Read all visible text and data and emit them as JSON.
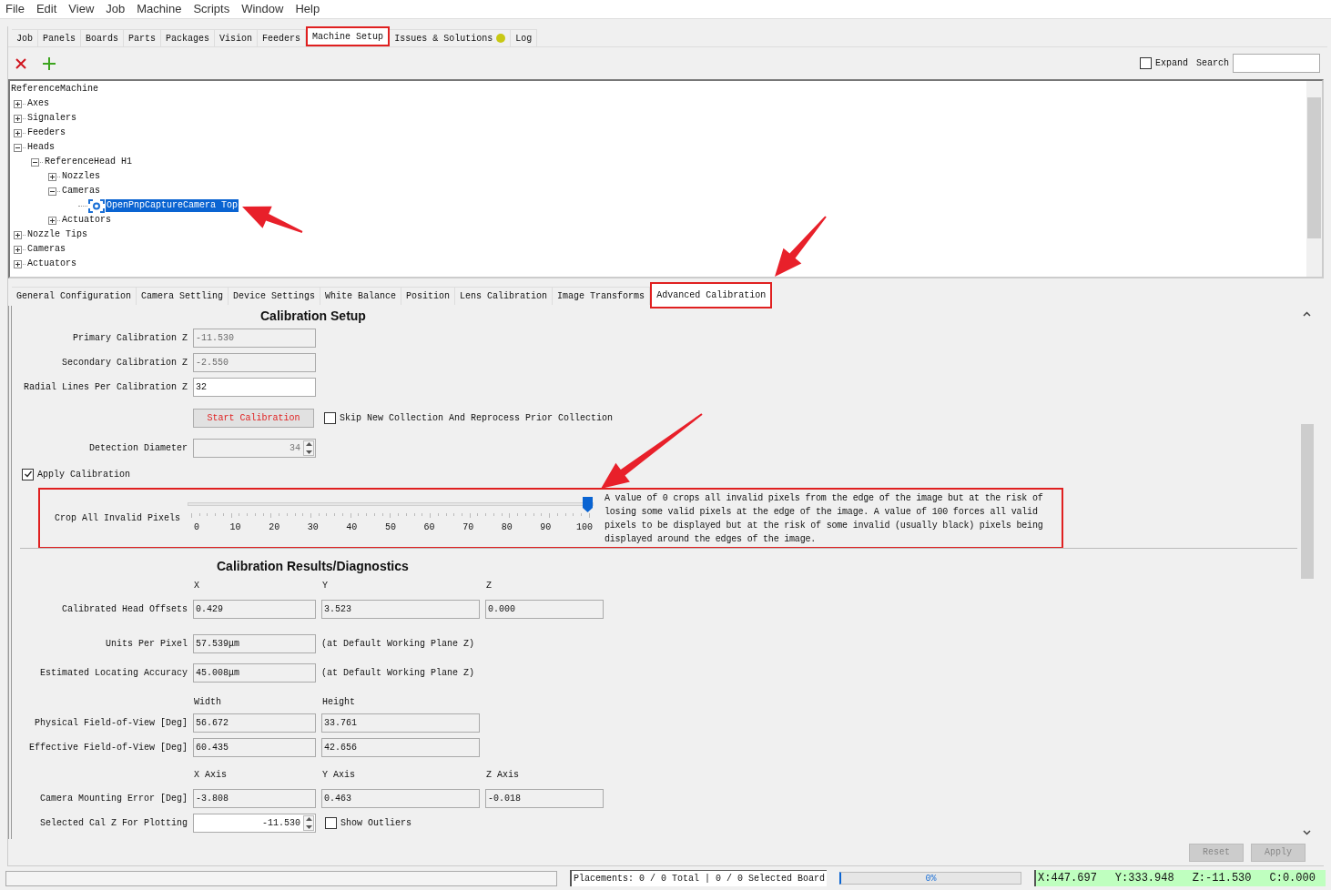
{
  "menu": [
    "File",
    "Edit",
    "View",
    "Job",
    "Machine",
    "Scripts",
    "Window",
    "Help"
  ],
  "main_tabs": [
    {
      "label": "Job",
      "selected": false
    },
    {
      "label": "Panels",
      "selected": false
    },
    {
      "label": "Boards",
      "selected": false
    },
    {
      "label": "Parts",
      "selected": false
    },
    {
      "label": "Packages",
      "selected": false
    },
    {
      "label": "Vision",
      "selected": false
    },
    {
      "label": "Feeders",
      "selected": false
    },
    {
      "label": "Machine Setup",
      "selected": true
    },
    {
      "label": "Issues & Solutions",
      "selected": false,
      "color": "#c8c814"
    },
    {
      "label": "Log",
      "selected": false
    }
  ],
  "toolbar": {
    "expand": {
      "label": "Expand",
      "checked": false
    },
    "search_label": "Search"
  },
  "tree": {
    "label": "ReferenceMachine",
    "selected": false,
    "children": [
      {
        "label": "Axes",
        "kind": "group",
        "selected": false,
        "expanded": false
      },
      {
        "label": "Signalers",
        "kind": "group",
        "selected": false,
        "expanded": false
      },
      {
        "label": "Feeders",
        "kind": "group",
        "selected": false,
        "expanded": false
      },
      {
        "label": "Heads",
        "kind": "group",
        "selected": false,
        "expanded": true,
        "children": [
          {
            "label": "ReferenceHead H1",
            "kind": "group",
            "selected": false,
            "expanded": true,
            "children": [
              {
                "label": "Nozzles",
                "kind": "group",
                "selected": false,
                "expanded": false
              },
              {
                "label": "Cameras",
                "kind": "group",
                "selected": false,
                "expanded": true,
                "children": [
                  {
                    "label": "OpenPnpCaptureCamera Top",
                    "kind": "camera",
                    "selected": true
                  }
                ]
              },
              {
                "label": "Actuators",
                "kind": "group",
                "selected": false,
                "expanded": false
              }
            ]
          }
        ]
      },
      {
        "label": "Nozzle Tips",
        "kind": "group",
        "selected": false,
        "expanded": false
      },
      {
        "label": "Cameras",
        "kind": "group",
        "selected": false,
        "expanded": false
      },
      {
        "label": "Actuators",
        "kind": "group",
        "selected": false,
        "expanded": false
      }
    ]
  },
  "sub_tabs": [
    {
      "label": "General Configuration",
      "selected": false
    },
    {
      "label": "Camera Settling",
      "selected": false
    },
    {
      "label": "Device Settings",
      "selected": false
    },
    {
      "label": "White Balance",
      "selected": false
    },
    {
      "label": "Position",
      "selected": false
    },
    {
      "label": "Lens Calibration",
      "selected": false
    },
    {
      "label": "Image Transforms",
      "selected": false
    },
    {
      "label": "Advanced Calibration",
      "selected": true
    }
  ],
  "calibration_setup": {
    "title": "Calibration Setup",
    "fields": [
      {
        "label": "Primary Calibration Z",
        "value": "-11.530",
        "disabled": true
      },
      {
        "label": "Secondary Calibration Z",
        "value": "-2.550",
        "disabled": true
      },
      {
        "label": "Radial Lines Per Calibration Z",
        "value": "32",
        "disabled": false
      }
    ],
    "start_button": "Start Calibration",
    "skip_checkbox": {
      "label": "Skip New Collection And Reprocess Prior Collection",
      "checked": false
    },
    "detection_diameter": {
      "label": "Detection Diameter",
      "value": "34",
      "disabled": true
    },
    "apply_calibration": {
      "label": "Apply Calibration",
      "checked": true
    },
    "crop": {
      "label": "Crop All Invalid Pixels",
      "level": 1,
      "ticks": [
        "0",
        "10",
        "20",
        "30",
        "40",
        "50",
        "60",
        "70",
        "80",
        "90",
        "100"
      ],
      "description": "A value of 0 crops all invalid pixels from the edge of the image but at the risk of losing some valid pixels at the edge of the image. A value of 100 forces all valid pixels to be displayed but at the risk of some invalid (usually black) pixels being displayed around the edges of the image."
    }
  },
  "results": {
    "title": "Calibration Results/Diagnostics",
    "sections": [
      {
        "headers": [
          "X",
          "Y",
          "Z"
        ],
        "rows": [
          {
            "label": "Calibrated Head Offsets",
            "values": [
              "0.429",
              "3.523",
              "0.000"
            ]
          }
        ]
      },
      {
        "rows": [
          {
            "label": "Units Per Pixel",
            "values": [
              "57.539μm"
            ],
            "note": "(at Default Working Plane Z)"
          },
          {
            "label": "Estimated Locating Accuracy",
            "values": [
              "45.008μm"
            ],
            "note": "(at Default Working Plane Z)"
          }
        ]
      },
      {
        "headers": [
          "Width",
          "Height"
        ],
        "rows": [
          {
            "label": "Physical Field-of-View [Deg]",
            "values": [
              "56.672",
              "33.761"
            ]
          },
          {
            "label": "Effective Field-of-View [Deg]",
            "values": [
              "60.435",
              "42.656"
            ]
          }
        ]
      },
      {
        "headers": [
          "X Axis",
          "Y Axis",
          "Z Axis"
        ],
        "rows": [
          {
            "label": "Camera Mounting Error [Deg]",
            "values": [
              "-3.808",
              "0.463",
              "-0.018"
            ]
          }
        ]
      }
    ],
    "plotting": {
      "label": "Selected Cal Z For Plotting",
      "value": "-11.530"
    },
    "show_outliers": {
      "label": "Show Outliers",
      "checked": false
    }
  },
  "buttons": [
    {
      "label": "Reset",
      "disabled": true
    },
    {
      "label": "Apply",
      "disabled": true
    }
  ],
  "status_bar": {
    "placements": "Placements: 0 / 0 Total | 0 / 0 Selected Board",
    "progress": {
      "level": 0,
      "label": "0%"
    },
    "coordinates": [
      "X:447.697",
      "Y:333.948",
      "Z:-11.530",
      "C:0.000"
    ]
  }
}
